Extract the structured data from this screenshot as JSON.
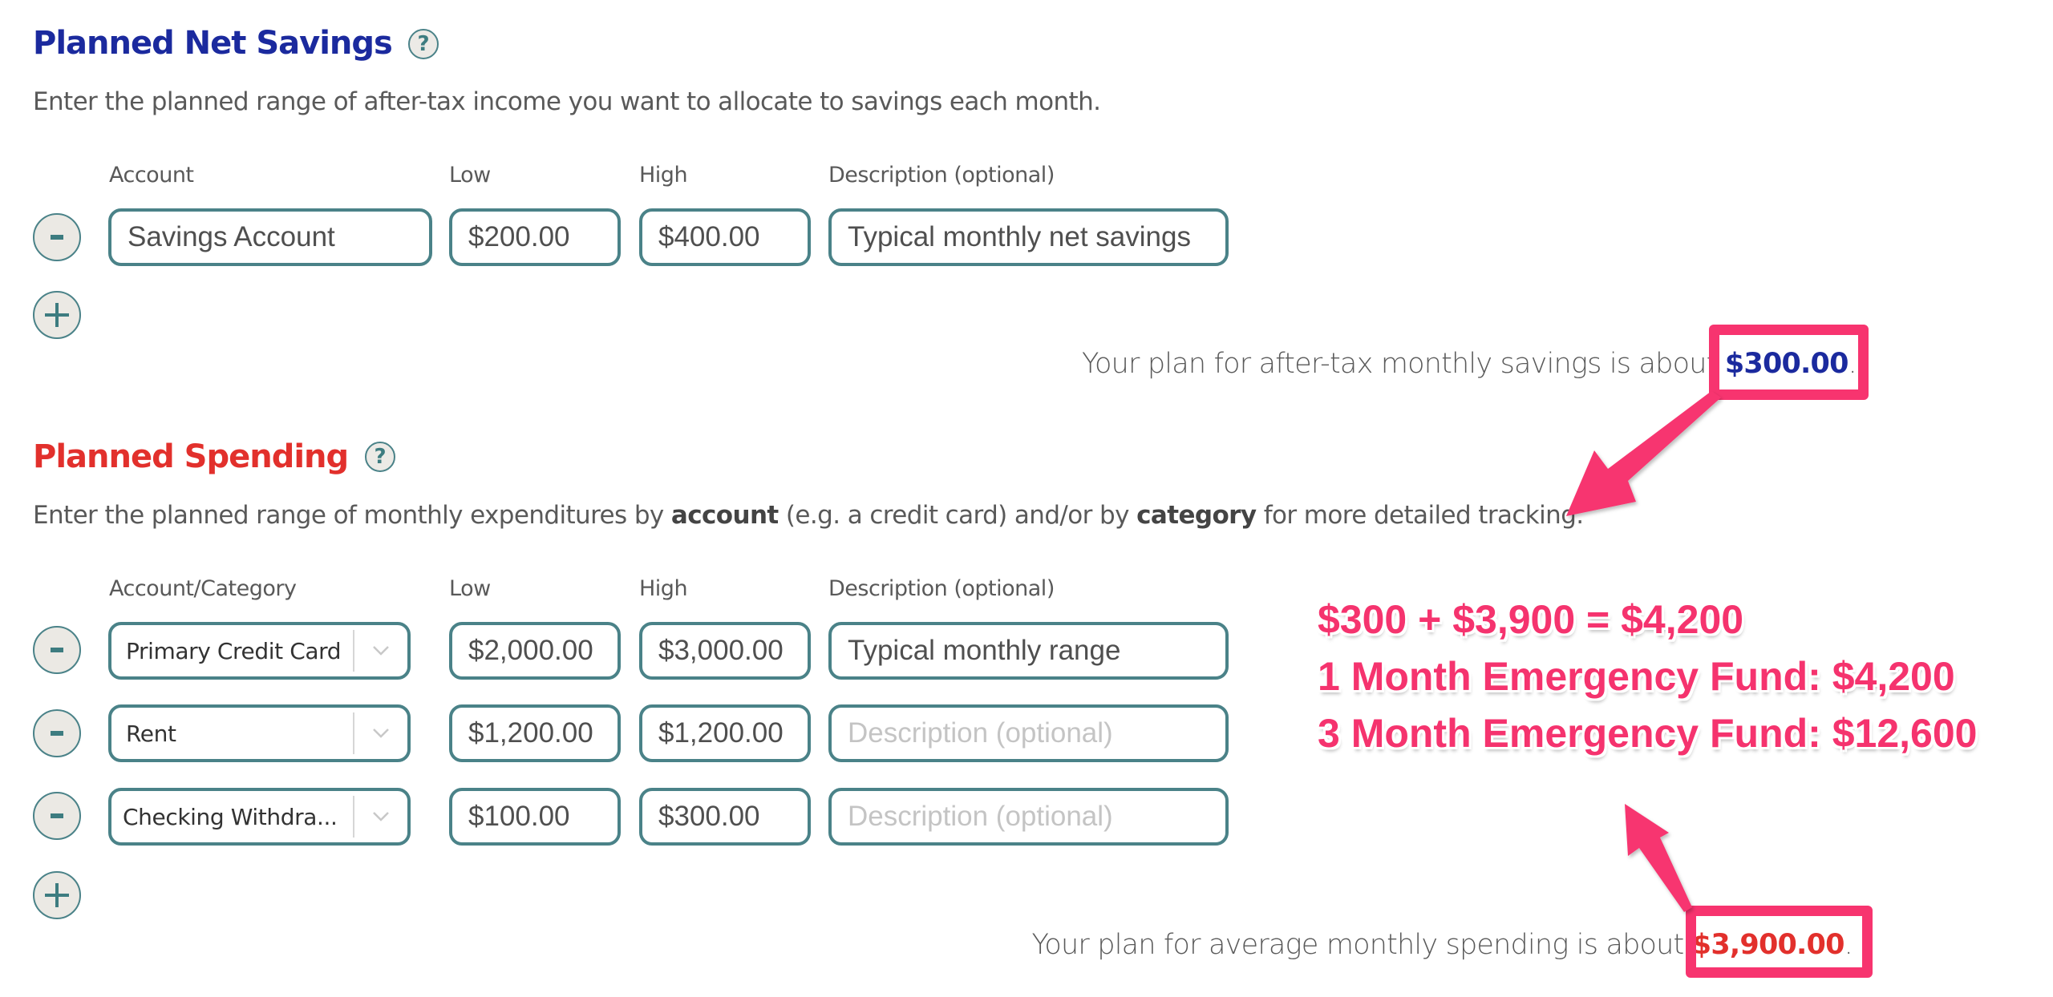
{
  "savings": {
    "title": "Planned Net Savings",
    "help_icon": "question-circle-icon",
    "description": "Enter the planned range of after-tax income you want to allocate to savings each month.",
    "columns": {
      "account": "Account",
      "low": "Low",
      "high": "High",
      "description": "Description (optional)"
    },
    "rows": [
      {
        "account": "Savings Account",
        "low": "$200.00",
        "high": "$400.00",
        "description": "Typical monthly net savings",
        "description_placeholder": "Description (optional)"
      }
    ],
    "remove_icon": "minus-icon",
    "add_icon": "plus-icon",
    "summary_prefix": "Your plan for after-tax monthly savings is about",
    "summary_amount": "$300.00",
    "summary_suffix": "."
  },
  "spending": {
    "title": "Planned Spending",
    "help_icon": "question-circle-icon",
    "description_parts": [
      "Enter the planned range of monthly expenditures by ",
      "account",
      " (e.g. a credit card) and/or by ",
      "category",
      " for more detailed tracking."
    ],
    "columns": {
      "account": "Account/Category",
      "low": "Low",
      "high": "High",
      "description": "Description (optional)"
    },
    "rows": [
      {
        "account": "Primary Credit Card",
        "low": "$2,000.00",
        "high": "$3,000.00",
        "description": "Typical monthly range",
        "description_placeholder": "Description (optional)"
      },
      {
        "account": "Rent",
        "low": "$1,200.00",
        "high": "$1,200.00",
        "description": "",
        "description_placeholder": "Description (optional)"
      },
      {
        "account": "Checking Withdra...",
        "low": "$100.00",
        "high": "$300.00",
        "description": "",
        "description_placeholder": "Description (optional)"
      }
    ],
    "remove_icon": "minus-icon",
    "add_icon": "plus-icon",
    "dropdown_icon": "chevron-down-icon",
    "summary_prefix": "Your plan for average monthly spending is about",
    "summary_amount": "$3,900.00",
    "summary_suffix": "."
  },
  "annotation": {
    "lines": [
      "$300 + $3,900 = $4,200",
      "1 Month Emergency Fund: $4,200",
      "3 Month Emergency Fund: $12,600"
    ],
    "color": "#f5336e"
  },
  "colors": {
    "savings_accent": "#1b2a9e",
    "spending_accent": "#e2302c",
    "input_border": "#4a8288",
    "annotation_pink": "#f7346f"
  }
}
